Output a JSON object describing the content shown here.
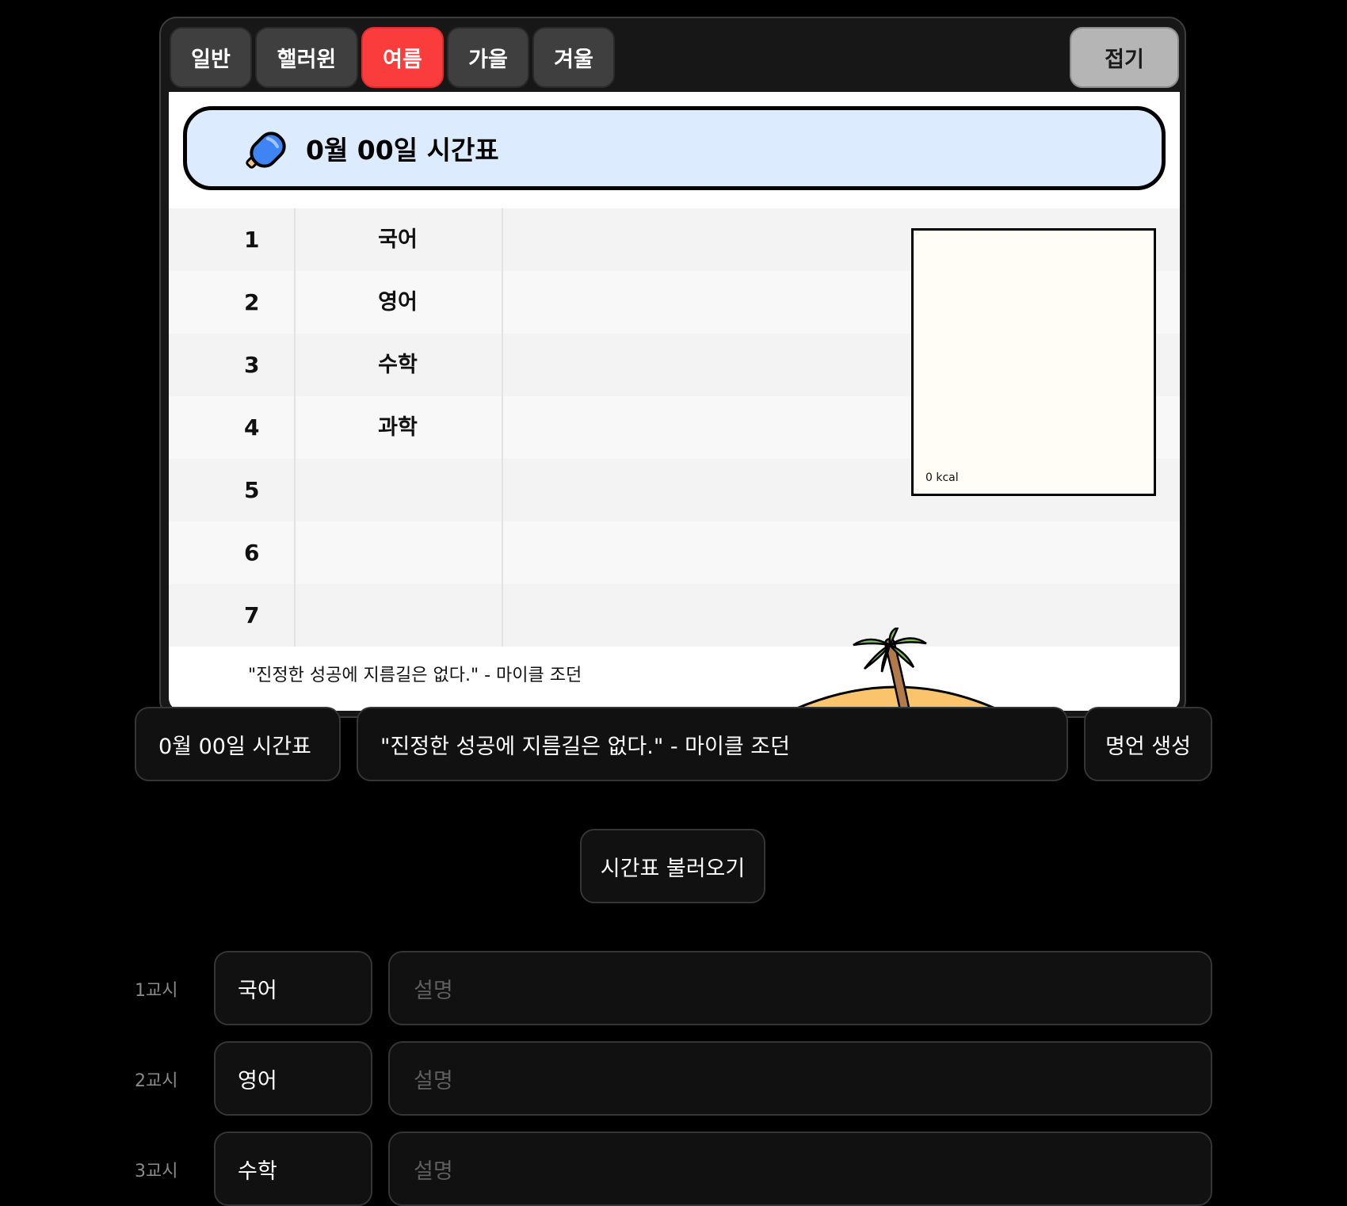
{
  "tabs": [
    {
      "label": "일반",
      "active": false
    },
    {
      "label": "핼러윈",
      "active": false
    },
    {
      "label": "여름",
      "active": true
    },
    {
      "label": "가을",
      "active": false
    },
    {
      "label": "겨울",
      "active": false
    }
  ],
  "fold_label": "접기",
  "preview": {
    "title": "0월 00일 시간표",
    "icon": "popsicle-icon",
    "periods": [
      {
        "num": "1",
        "subject": "국어"
      },
      {
        "num": "2",
        "subject": "영어"
      },
      {
        "num": "3",
        "subject": "수학"
      },
      {
        "num": "4",
        "subject": "과학"
      },
      {
        "num": "5",
        "subject": ""
      },
      {
        "num": "6",
        "subject": ""
      },
      {
        "num": "7",
        "subject": ""
      }
    ],
    "meal_kcal": "0 kcal",
    "quote": "\"진정한 성공에 지름길은 없다.\" - 마이클 조던",
    "decoration": "palm-island-icon"
  },
  "controls": {
    "title_value": "0월 00일 시간표",
    "quote_value": "\"진정한 성공에 지름길은 없다.\" - 마이클 조던",
    "quote_button": "명언 생성",
    "load_button": "시간표 불러오기"
  },
  "period_inputs": [
    {
      "label": "1교시",
      "subject": "국어",
      "desc_placeholder": "설명"
    },
    {
      "label": "2교시",
      "subject": "영어",
      "desc_placeholder": "설명"
    },
    {
      "label": "3교시",
      "subject": "수학",
      "desc_placeholder": "설명"
    }
  ],
  "colors": {
    "accent_active_tab": "#fb3c3c",
    "title_bg": "#dcebfd",
    "background": "#000000"
  }
}
